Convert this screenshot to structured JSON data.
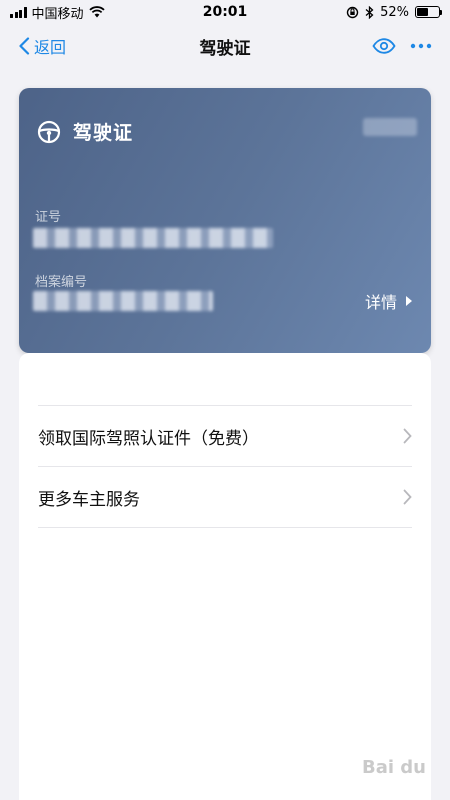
{
  "status_bar": {
    "carrier": "中国移动",
    "time": "20:01",
    "battery_percent": "52%",
    "battery_level": 0.52,
    "icons": [
      "signal-icon",
      "wifi-icon",
      "orientation-lock-icon",
      "bluetooth-icon",
      "battery-icon"
    ]
  },
  "nav": {
    "back_label": "返回",
    "title": "驾驶证",
    "icons": [
      "chevron-left-icon",
      "eye-icon",
      "more-icon"
    ]
  },
  "card": {
    "title": "驾驶证",
    "number_label": "证号",
    "file_number_label": "档案编号",
    "details_label": "详情",
    "icons": [
      "steering-wheel-icon",
      "triangle-right-icon"
    ],
    "colors": {
      "gradient_start": "#4d6388",
      "gradient_end": "#6d88b0"
    }
  },
  "menu": [
    {
      "label": "领取国际驾照认证件（免费）"
    },
    {
      "label": "更多车主服务"
    }
  ],
  "accent_color": "#1e88e5"
}
